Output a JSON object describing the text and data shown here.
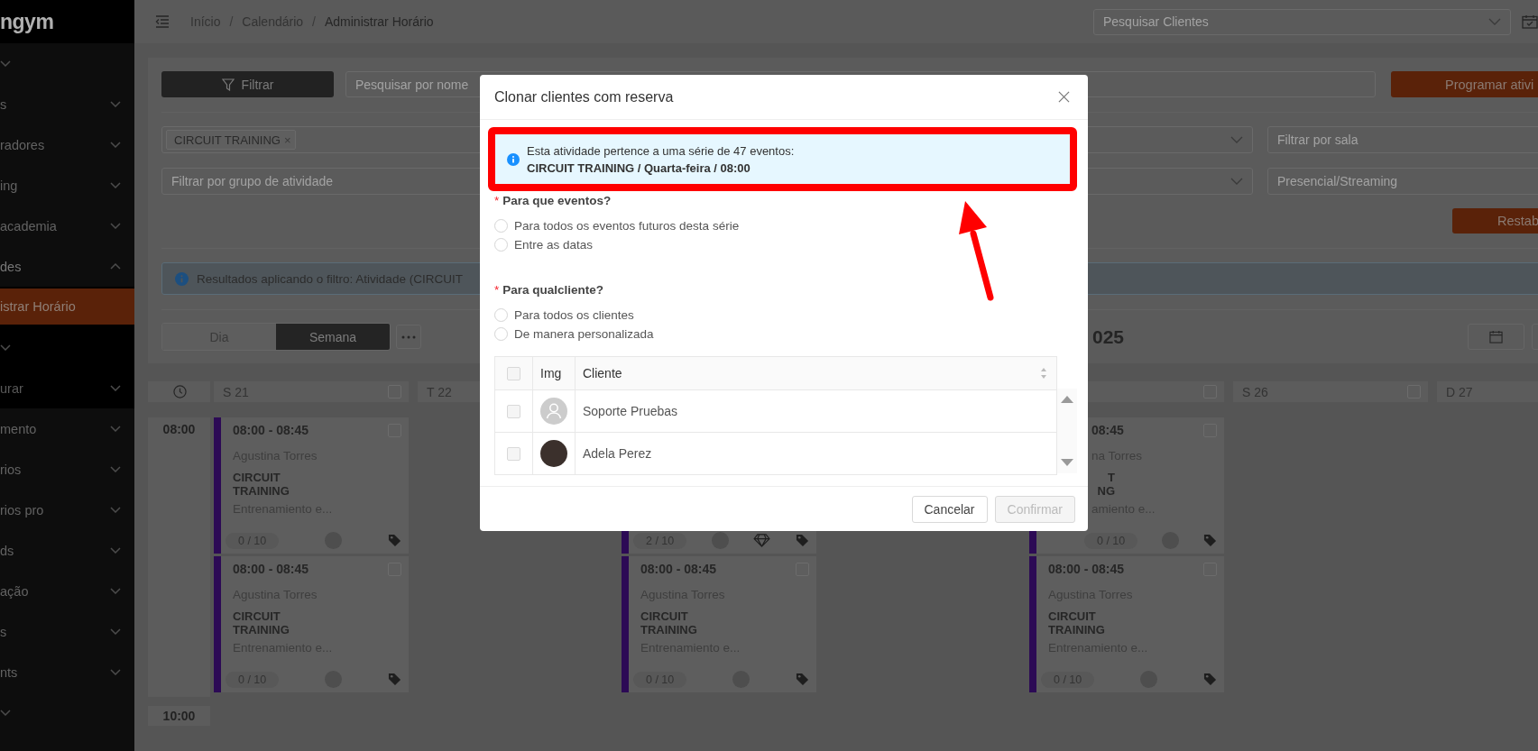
{
  "sidebar": {
    "logo": "ngym",
    "items": [
      {
        "expanded": false
      },
      {
        "label": "s",
        "expanded": false
      },
      {
        "label": "radores",
        "expanded": false
      },
      {
        "label": "ing",
        "expanded": false
      },
      {
        "label": "academia",
        "expanded": false
      },
      {
        "label": "des",
        "expanded": true,
        "children": [
          {
            "label": "istrar Horário",
            "selected": true
          },
          {
            "selected": false,
            "expanded": false
          },
          {
            "label": "urar",
            "selected": false,
            "expanded": false
          }
        ]
      },
      {
        "label": "mento",
        "expanded": false
      },
      {
        "label": "rios",
        "expanded": false
      },
      {
        "label": "rios pro",
        "expanded": false
      },
      {
        "label": "ds",
        "expanded": false
      },
      {
        "label": "ação",
        "expanded": false
      },
      {
        "label": "s",
        "expanded": false
      },
      {
        "label": "nts",
        "expanded": false
      },
      {
        "expanded": false
      }
    ]
  },
  "topbar": {
    "breadcrumb": {
      "items": [
        "Início",
        "Calendário",
        "Administrar Horário"
      ],
      "separator": "/"
    },
    "client_search": {
      "placeholder": "Pesquisar Clientes"
    }
  },
  "filters": {
    "filter_button": "Filtrar",
    "search": {
      "placeholder": "Pesquisar por nome"
    },
    "schedule_button": "Programar ativi",
    "activity_select": {
      "tags": [
        {
          "label": "CIRCUIT TRAINING",
          "remove": "×"
        }
      ]
    },
    "room_filter": {
      "placeholder": "Filtrar por sala"
    },
    "group_filter": {
      "placeholder": "Filtrar por grupo de atividade"
    },
    "mode_filter": {
      "placeholder": "Presencial/Streaming"
    },
    "reset_button": "Restab",
    "alert": "Resultados aplicando o filtro: Atividade (CIRCUIT"
  },
  "view": {
    "options": [
      {
        "label": "Dia",
        "selected": false
      },
      {
        "label": "Semana",
        "selected": true
      }
    ],
    "title": "025"
  },
  "calendar": {
    "time_slots": [
      "08:00",
      "10:00"
    ],
    "columns": [
      {
        "header": {
          "label": "S 21",
          "checked": false
        },
        "events": [
          {
            "kind": "full",
            "time": "08:00 - 08:45",
            "trainer": "Agustina Torres",
            "activity": "CIRCUIT TRAINING",
            "description": "Entrenamiento e...",
            "count": "0 / 10",
            "checked": false,
            "premium": false
          },
          {
            "kind": "full",
            "time": "08:00 - 08:45",
            "trainer": "Agustina Torres",
            "activity": "CIRCUIT TRAINING",
            "description": "Entrenamiento e...",
            "count": "0 / 10",
            "checked": false,
            "premium": false
          }
        ]
      },
      {
        "header": {
          "label": "T 22"
        }
      },
      {
        "events": [
          {
            "kind": "covered",
            "count": "2 / 10",
            "premium": true
          },
          {
            "kind": "full",
            "time": "08:00 - 08:45",
            "trainer": "Agustina Torres",
            "activity": "CIRCUIT TRAINING",
            "description": "Entrenamiento e...",
            "count": "0 / 10",
            "checked": false,
            "premium": false
          }
        ]
      },
      {},
      {
        "header": {
          "checked": false
        },
        "events": [
          {
            "kind": "cut",
            "time": "08:45",
            "trainer": "na Torres",
            "activity": "T NG",
            "description": "amiento e...",
            "count": "0 / 10",
            "checked": false,
            "premium": false
          },
          {
            "kind": "full",
            "time": "08:00 - 08:45",
            "trainer": "Agustina Torres",
            "activity": "CIRCUIT TRAINING",
            "description": "Entrenamiento e...",
            "count": "0 / 10",
            "checked": false,
            "premium": false
          }
        ]
      },
      {
        "header": {
          "label": "S 26",
          "checked": false
        }
      },
      {
        "header": {
          "label": "D 27"
        }
      }
    ]
  },
  "modal": {
    "title": "Clonar clientes com reserva",
    "series_alert": {
      "text": "Esta atividade pertence a uma série de 47 eventos:",
      "detail": "CIRCUIT TRAINING / Quarta-feira / 08:00"
    },
    "questions": [
      {
        "required_mark": "*",
        "label": "Para que eventos?",
        "options": [
          {
            "label": "Para todos os eventos futuros desta série",
            "selected": false
          },
          {
            "label": "Entre as datas",
            "selected": false
          }
        ]
      },
      {
        "required_mark": "*",
        "label": "Para qualcliente?",
        "options": [
          {
            "label": "Para todos os clientes",
            "selected": false
          },
          {
            "label": "De manera personalizada",
            "selected": false
          }
        ]
      }
    ],
    "client_table": {
      "columns": [
        "Img",
        "Cliente"
      ],
      "all_checked": false,
      "rows": [
        {
          "avatar": {
            "kind": "placeholder"
          },
          "name": "Soporte Pruebas",
          "checked": false
        },
        {
          "avatar": {
            "kind": "photo"
          },
          "name": "Adela Perez",
          "checked": false
        }
      ]
    },
    "buttons": [
      {
        "label": "Cancelar",
        "disabled": false
      },
      {
        "label": "Confirmar",
        "disabled": true
      }
    ]
  },
  "annotations": {
    "highlight_box": true,
    "arrow": true
  }
}
